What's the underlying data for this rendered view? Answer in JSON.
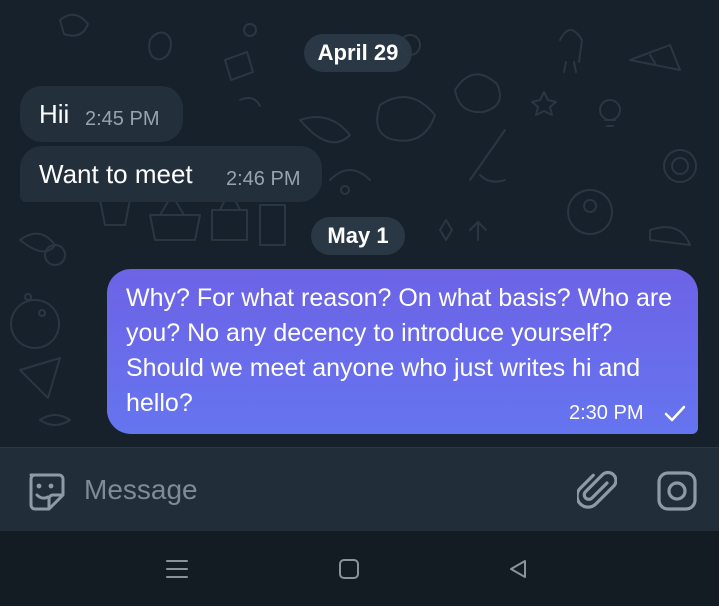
{
  "chat": {
    "dates": [
      "April 29",
      "May 1"
    ],
    "incoming": [
      {
        "text": "Hii",
        "time": "2:45 PM"
      },
      {
        "text": "Want to meet",
        "time": "2:46 PM"
      }
    ],
    "outgoing": {
      "text": "Why? For what reason? On what basis? Who are you? No any decency to introduce yourself? Should we meet anyone who just writes hi and hello?",
      "time": "2:30 PM",
      "status_icon": "single-check-icon"
    }
  },
  "composer": {
    "placeholder": "Message",
    "left_icon": "sticker-icon",
    "right_icons": [
      "paperclip-icon",
      "camera-icon"
    ]
  },
  "navbar": {
    "icons": [
      "menu-icon",
      "home-icon",
      "back-icon"
    ]
  },
  "colors": {
    "chat_background": "#17212b",
    "incoming_bubble": "#232f3b",
    "outgoing_gradient_start": "#6d63e6",
    "outgoing_gradient_end": "#6574ef",
    "composer_background": "#212d38"
  }
}
